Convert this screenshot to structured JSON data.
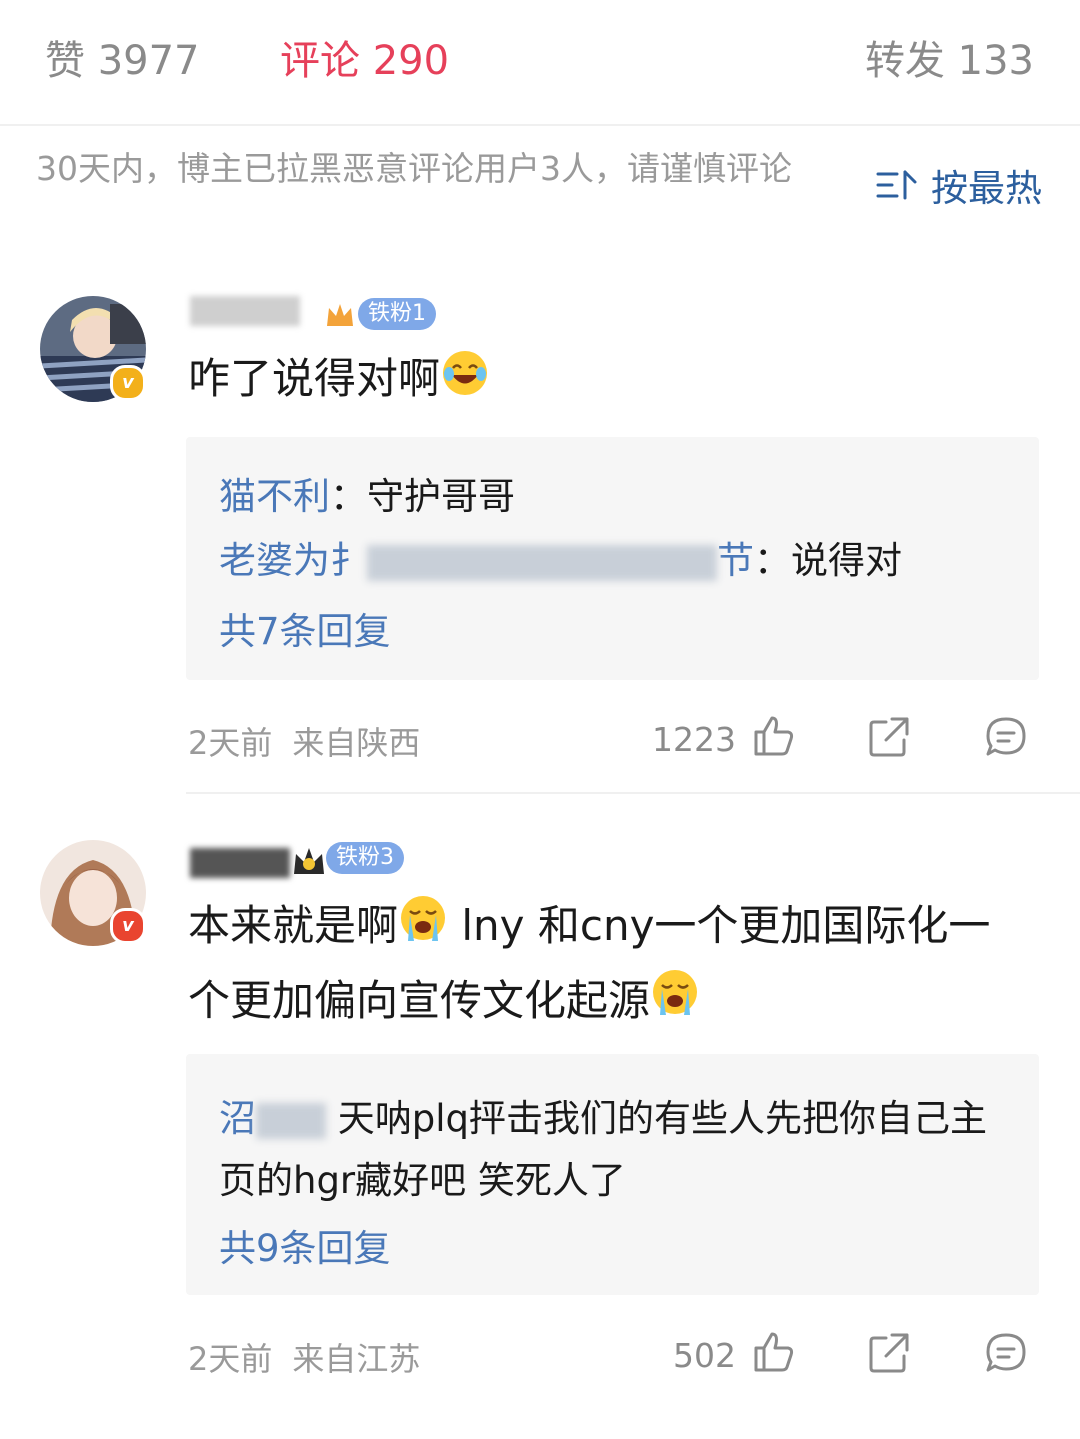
{
  "tabs": {
    "likes": "赞 3977",
    "comments": "评论 290",
    "reposts": "转发 133"
  },
  "notice": "30天内，博主已拉黑恶意评论用户3人，请谨慎评论",
  "sort": {
    "label": "按最热",
    "icon": "sort-icon"
  },
  "comments": [
    {
      "fan_badge": "铁粉1",
      "text": "咋了说得对啊",
      "emoji": "laugh-tears",
      "replies": [
        {
          "name": "猫不利",
          "sep": "：",
          "content": "守护哥哥"
        },
        {
          "name_start": "老婆为扌",
          "name_end": "节",
          "sep": "：",
          "content": "说得对"
        }
      ],
      "more": "共7条回复",
      "time": "2天前",
      "location": "来自陕西",
      "likes": "1223"
    },
    {
      "fan_badge": "铁粉3",
      "text_part1": "本来就是啊",
      "text_part2": " lny 和cny一个更加国际化一个更加偏向宣传文化起源",
      "emoji": "crying",
      "replies": [
        {
          "name": "沼",
          "content": "天呐plq抨击我们的有些人先把你自己主页的hgr藏好吧 笑死人了"
        }
      ],
      "more": "共9条回复",
      "time": "2天前",
      "location": "来自江苏",
      "likes": "502"
    }
  ],
  "colors": {
    "accent": "#e6405a",
    "link": "#4a78b8",
    "muted": "#9a9a9a"
  }
}
